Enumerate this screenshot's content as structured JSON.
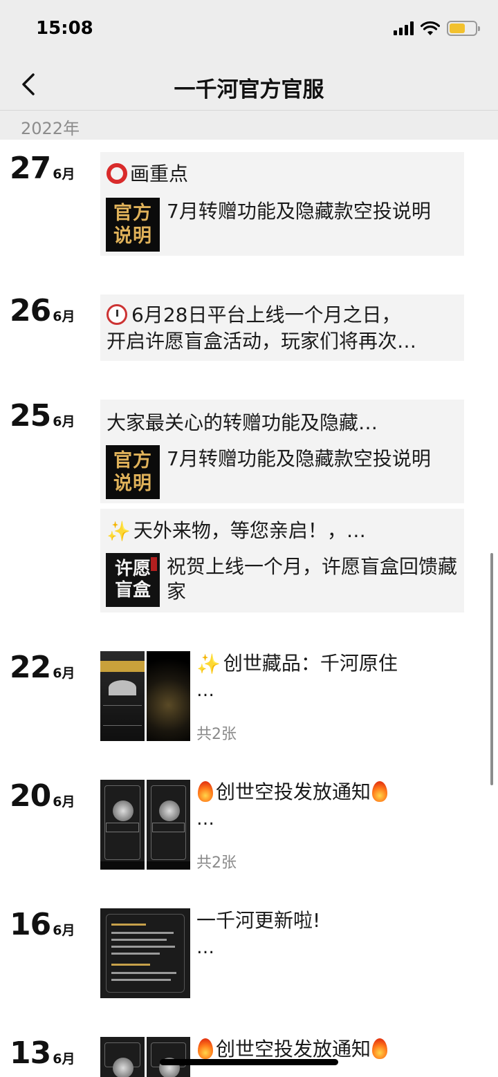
{
  "status": {
    "time": "15:08"
  },
  "nav": {
    "title": "一千河官方官服",
    "back_label": "返回"
  },
  "year": "2022年",
  "entries": [
    {
      "day": "27",
      "month": "6月",
      "cards": [
        {
          "text": "画重点",
          "badge": [
            "官方",
            "说明"
          ],
          "sub": "7月转赠功能及隐藏款空投说明"
        }
      ]
    },
    {
      "day": "26",
      "month": "6月",
      "cards": [
        {
          "line1": "6月28日平台上线一个月之日，",
          "line2": "开启许愿盲盒活动，玩家们将再次…"
        }
      ]
    },
    {
      "day": "25",
      "month": "6月",
      "cards": [
        {
          "text": "大家最关心的转赠功能及隐藏…",
          "badge": [
            "官方",
            "说明"
          ],
          "sub": "7月转赠功能及隐藏款空投说明"
        },
        {
          "text": "天外来物，等您亲启！，…",
          "badge": [
            "许愿",
            "盲盒"
          ],
          "sub": "祝贺上线一个月，许愿盲盒回馈藏家"
        }
      ]
    },
    {
      "day": "22",
      "month": "6月",
      "text": "创世藏品：千河原住",
      "dots": "…",
      "count": "共2张"
    },
    {
      "day": "20",
      "month": "6月",
      "text": "创世空投发放通知",
      "dots": "…",
      "count": "共2张"
    },
    {
      "day": "16",
      "month": "6月",
      "text": "一千河更新啦!",
      "dots": "…"
    },
    {
      "day": "13",
      "month": "6月",
      "text": "创世空投发放通知"
    }
  ]
}
